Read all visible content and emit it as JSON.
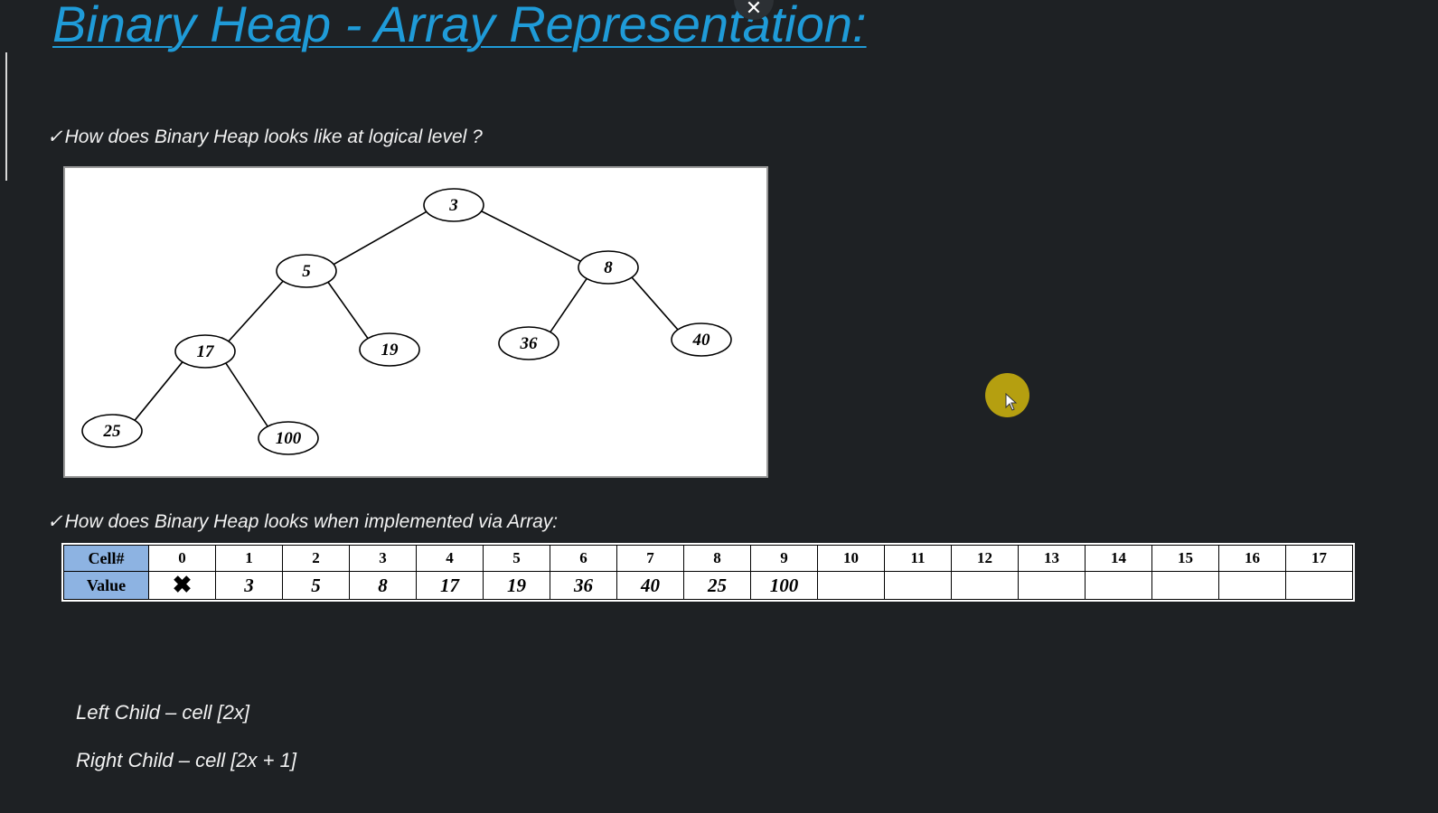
{
  "slide": {
    "title": "Binary Heap - Array Representation:",
    "question_logical": "How does Binary Heap looks like at logical level ?",
    "question_array": "How does Binary Heap looks when implemented via Array:",
    "check_mark": "✓",
    "close_glyph": "✕",
    "title_color": "#1f9bd8",
    "background_color": "#1e2124"
  },
  "tree": {
    "nodes": [
      {
        "id": "n3",
        "label": "3"
      },
      {
        "id": "n5",
        "label": "5"
      },
      {
        "id": "n8",
        "label": "8"
      },
      {
        "id": "n17",
        "label": "17"
      },
      {
        "id": "n19",
        "label": "19"
      },
      {
        "id": "n36",
        "label": "36"
      },
      {
        "id": "n40",
        "label": "40"
      },
      {
        "id": "n25",
        "label": "25"
      },
      {
        "id": "n100",
        "label": "100"
      }
    ],
    "edges": [
      [
        "n3",
        "n5"
      ],
      [
        "n3",
        "n8"
      ],
      [
        "n5",
        "n17"
      ],
      [
        "n5",
        "n19"
      ],
      [
        "n8",
        "n36"
      ],
      [
        "n8",
        "n40"
      ],
      [
        "n17",
        "n25"
      ],
      [
        "n17",
        "n100"
      ]
    ]
  },
  "array_table": {
    "cell_header": "Cell#",
    "value_header": "Value",
    "header_color": "#8db3e2",
    "cells": [
      "0",
      "1",
      "2",
      "3",
      "4",
      "5",
      "6",
      "7",
      "8",
      "9",
      "10",
      "11",
      "12",
      "13",
      "14",
      "15",
      "16",
      "17"
    ],
    "values": [
      "✖",
      "3",
      "5",
      "8",
      "17",
      "19",
      "36",
      "40",
      "25",
      "100",
      "",
      "",
      "",
      "",
      "",
      "",
      "",
      ""
    ]
  },
  "formulas": {
    "left_child": "Left Child – cell [2x]",
    "right_child": "Right Child – cell [2x + 1]"
  },
  "cursor": {
    "icon": "pointer-arrow-icon",
    "highlight_color": "#b59f10"
  }
}
